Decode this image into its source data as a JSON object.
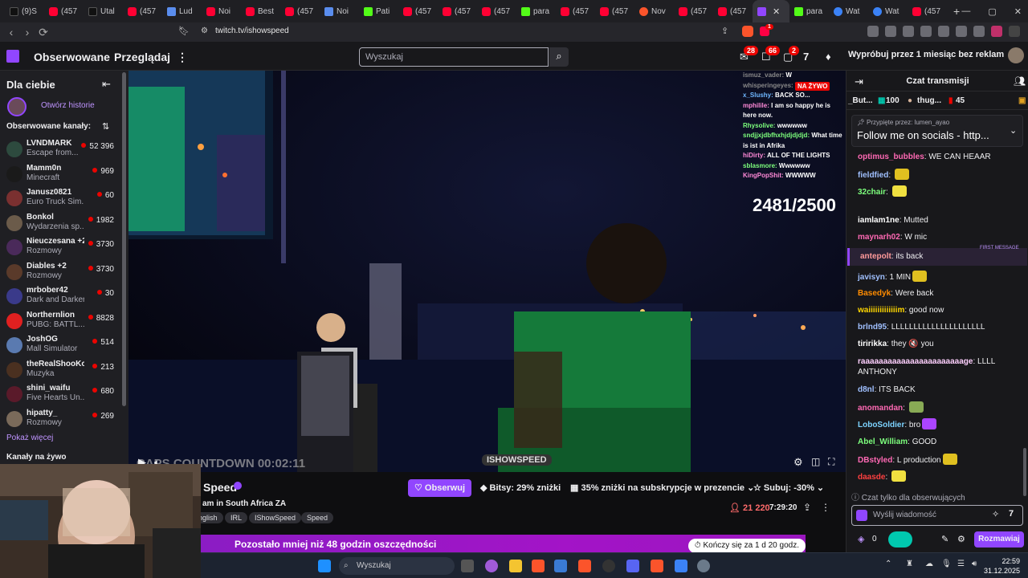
{
  "browser": {
    "tabs": [
      {
        "label": "(9)S",
        "icon": "tiktok-icon"
      },
      {
        "label": "(457",
        "icon": "youtube-icon"
      },
      {
        "label": "Utal",
        "icon": "tiktok-icon"
      },
      {
        "label": "(457",
        "icon": "youtube-icon"
      },
      {
        "label": "Lud",
        "icon": "site-icon"
      },
      {
        "label": "Noi",
        "icon": "youtube-icon"
      },
      {
        "label": "Best",
        "icon": "youtube-icon"
      },
      {
        "label": "(457",
        "icon": "youtube-icon"
      },
      {
        "label": "Noi",
        "icon": "site-icon"
      },
      {
        "label": "Pati",
        "icon": "kick-icon"
      },
      {
        "label": "(457",
        "icon": "youtube-icon"
      },
      {
        "label": "(457",
        "icon": "youtube-icon"
      },
      {
        "label": "(457",
        "icon": "youtube-icon"
      },
      {
        "label": "para",
        "icon": "kick-icon"
      },
      {
        "label": "(457",
        "icon": "youtube-icon"
      },
      {
        "label": "(457",
        "icon": "youtube-icon"
      },
      {
        "label": "Nov",
        "icon": "brave-icon"
      },
      {
        "label": "(457",
        "icon": "youtube-icon"
      },
      {
        "label": "(457",
        "icon": "youtube-icon"
      },
      {
        "label": "",
        "icon": "twitch-icon",
        "active": true
      },
      {
        "label": "para",
        "icon": "kick-icon"
      },
      {
        "label": "Wat",
        "icon": "edge-icon"
      },
      {
        "label": "Wat",
        "icon": "edge-icon"
      },
      {
        "label": "(457",
        "icon": "youtube-icon"
      }
    ],
    "url": "twitch.tv/ishowspeed",
    "brave_badge": "1"
  },
  "twitch": {
    "nav": {
      "following": "Obserwowane",
      "browse": "Przeglądaj",
      "more": "⋮"
    },
    "search_placeholder": "Wyszukaj",
    "badges": {
      "inbox": "28",
      "notifications": "66",
      "whispers": "2"
    },
    "promo": "Wypróbuj przez 1 miesiąc bez reklam"
  },
  "sidebar": {
    "for_you": "Dla ciebie",
    "stories": "Otwórz historie",
    "followed_header": "Obserwowane kanały:",
    "channels": [
      {
        "name": "LVNDMARK",
        "game": "Escape from...",
        "viewers": "52 396",
        "color": "#2d4a3e"
      },
      {
        "name": "Mamm0n",
        "game": "Minecraft",
        "viewers": "969",
        "color": "#1a1a1a"
      },
      {
        "name": "Janusz0821",
        "game": "Euro Truck Sim...",
        "viewers": "60",
        "color": "#7a3030"
      },
      {
        "name": "Bonkol",
        "game": "Wydarzenia sp...",
        "viewers": "1982",
        "color": "#6b5b4a"
      },
      {
        "name": "Nieuczesana +2",
        "game": "Rozmowy",
        "viewers": "3730",
        "color": "#4a2a5a"
      },
      {
        "name": "Diables +2",
        "game": "Rozmowy",
        "viewers": "3730",
        "color": "#5a3a2a"
      },
      {
        "name": "mrbober42",
        "game": "Dark and Darker",
        "viewers": "30",
        "color": "#3a3a8a"
      },
      {
        "name": "Northernlion",
        "game": "PUBG: BATTL...",
        "viewers": "8828",
        "color": "#e02020"
      },
      {
        "name": "JoshOG",
        "game": "Mall Simulator",
        "viewers": "514",
        "color": "#5a7ab0"
      },
      {
        "name": "theRealShooKo...",
        "game": "Muzyka",
        "viewers": "213",
        "color": "#4a3020"
      },
      {
        "name": "shini_waifu",
        "game": "Five Hearts Un...",
        "viewers": "680",
        "color": "#5a1a2a"
      },
      {
        "name": "hipatty_",
        "game": "Rozmowy",
        "viewers": "269",
        "color": "#7a6a5a"
      }
    ],
    "show_more": "Pokaż więcej",
    "live_channels": "Kanały na żywo"
  },
  "player": {
    "live_badge": "NA ŻYWO",
    "counter": "2481/2500",
    "countdown": "CAPS COUNTDOWN 00:02:11",
    "stream_logo": "ISHOWSPEED",
    "overlay_chat": [
      {
        "user": "ismuz_vader:",
        "text": "W",
        "color": "#888"
      },
      {
        "user": "whisperingeyes:",
        "text": "W",
        "color": "#888"
      },
      {
        "user": "x_Slushy:",
        "text": "BACK SO...",
        "color": "#6fb7ff"
      },
      {
        "user": "mphilile:",
        "text": "I am so happy he is here now.",
        "color": "#ff8ad8"
      },
      {
        "user": "Rhysolive:",
        "text": "wwwwww",
        "color": "#7dff7d"
      },
      {
        "user": "sndjjxjdbfhxhjdjdjdjd:",
        "text": "What time is ist in Afrika",
        "color": "#7dff7d"
      },
      {
        "user": "hiDirty:",
        "text": "ALL OF THE LIGHTS",
        "color": "#ff8ad8"
      },
      {
        "user": "sblasmore:",
        "text": "Wwwwww",
        "color": "#7dff7d"
      },
      {
        "user": "KingPopShit:",
        "text": "WWWWW",
        "color": "#ff8ad8"
      }
    ]
  },
  "stream": {
    "channel_name": "Speed",
    "title": "am in South Africa ZA",
    "tags": [
      "nglish",
      "IRL",
      "IShowSpeed",
      "Speed"
    ],
    "follow": "Obserwuj",
    "bits": "Bitsy: 29% zniżki",
    "sub_gift": "35% zniżki na subskrypcje w prezencie",
    "sub": "Subuj: -30%",
    "viewers": "21 220",
    "uptime": "7:29:20",
    "banner": "Pozostało mniej niż 48 godzin oszczędności",
    "banner_timer": "Kończy się za 1 d 20 godz."
  },
  "chat": {
    "header": "Czat transmisji",
    "hype_left": "_But...",
    "hype_count1": "100",
    "hype_user": "thug...",
    "hype_count2": "45",
    "pinned_by": "Przypięte przez: lumen_ayao",
    "pinned_text": "Follow me on socials - http...",
    "first_message": "FIRST MESSAGE",
    "messages": [
      {
        "user": "optimus_bubbles",
        "sep": ": ",
        "text": "WE CAN HEAAR",
        "color": "#ff69b4"
      },
      {
        "user": "fieldfied",
        "sep": ": ",
        "text": "",
        "color": "#a0c0ff"
      },
      {
        "user": "32chair",
        "sep": ": ",
        "text": "",
        "color": "#7dff7d"
      },
      {
        "user": "iamlam1ne",
        "sep": ": ",
        "text": "Mutted",
        "color": "#ffffff"
      },
      {
        "user": "maynarh02",
        "sep": ": ",
        "text": "W mic",
        "color": "#ff69b4"
      },
      {
        "user": "antepolt",
        "sep": ": ",
        "text": "its back",
        "color": "#ff9a9a"
      },
      {
        "user": "javisyn",
        "sep": ": ",
        "text": "1 MIN",
        "color": "#a0c0ff"
      },
      {
        "user": "Basedyk",
        "sep": ": ",
        "text": "Were back",
        "color": "#ff8c00"
      },
      {
        "user": "waiiiiiiiiiiiiim",
        "sep": ": ",
        "text": "good now",
        "color": "#ffd700"
      },
      {
        "user": "brlnd95",
        "sep": ": ",
        "text": "LLLLLLLLLLLLLLLLLLLLL",
        "color": "#a0c0ff"
      },
      {
        "user": "tiririkka",
        "sep": ": ",
        "text": "they 🔇 you",
        "color": "#ffffff"
      },
      {
        "user": "raaaaaaaaaaaaaaaaaaaaaaage",
        "sep": ": ",
        "text": "LLLL ANTHONY",
        "color": "#ffd0ff"
      },
      {
        "user": "d8nl",
        "sep": ": ",
        "text": "ITS BACK",
        "color": "#a0c0ff"
      },
      {
        "user": "anomandan",
        "sep": ": ",
        "text": "",
        "color": "#ff69b4"
      },
      {
        "user": "LoboSoldier",
        "sep": ": ",
        "text": "bro",
        "color": "#7dd3ff"
      },
      {
        "user": "Abel_William",
        "sep": ": ",
        "text": "GOOD",
        "color": "#7dff7d"
      },
      {
        "user": "DBstyled",
        "sep": ": ",
        "text": "L production",
        "color": "#ff69b4"
      },
      {
        "user": "daasde",
        "sep": ": ",
        "text": "",
        "color": "#ff4040"
      }
    ],
    "followers_only": "Czat tylko dla obserwujących",
    "input_placeholder": "Wyślij wiadomość",
    "points": "0",
    "send": "Rozmawiaj"
  },
  "taskbar": {
    "search": "Wyszukaj",
    "time": "22:59",
    "date": "31.12.2025"
  }
}
